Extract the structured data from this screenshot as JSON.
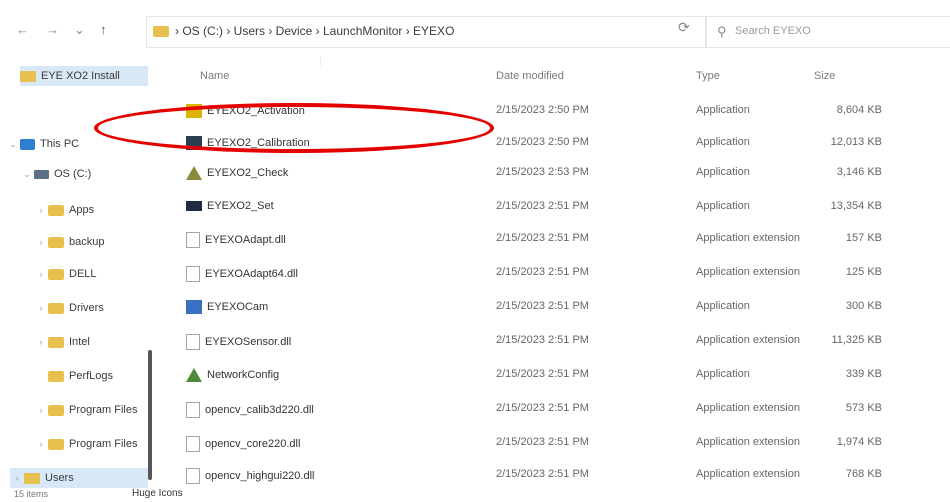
{
  "nav": {
    "back": "←",
    "forward": "→",
    "recent": "⌄",
    "up": "↑"
  },
  "address": {
    "path": "› OS (C:) › Users › Device › LaunchMonitor › EYEXO",
    "dropdown": "⌄",
    "refresh": "⟳"
  },
  "search": {
    "placeholder": "Search EYEXO",
    "icon": "search-icon"
  },
  "sidebar": {
    "items": [
      {
        "label": "EYE XO2 Install",
        "chev": ""
      },
      {
        "label": "This PC",
        "chev": "⌄"
      },
      {
        "label": "OS (C:)",
        "chev": "⌄"
      },
      {
        "label": "Apps",
        "chev": "›"
      },
      {
        "label": "backup",
        "chev": "›"
      },
      {
        "label": "DELL",
        "chev": "›"
      },
      {
        "label": "Drivers",
        "chev": "›"
      },
      {
        "label": "Intel",
        "chev": "›"
      },
      {
        "label": "PerfLogs",
        "chev": ""
      },
      {
        "label": "Program Files",
        "chev": "›"
      },
      {
        "label": "Program Files",
        "chev": "›"
      },
      {
        "label": "Users",
        "chev": "›"
      }
    ]
  },
  "columns": {
    "name": "Name",
    "date": "Date modified",
    "type": "Type",
    "size": "Size"
  },
  "files": [
    {
      "name": "EYEXO2_Activation",
      "date": "2/15/2023 2:50 PM",
      "type": "Application",
      "size": "8,604 KB",
      "icon": "activation-icon"
    },
    {
      "name": "EYEXO2_Calibration",
      "date": "2/15/2023 2:50 PM",
      "type": "Application",
      "size": "12,013 KB",
      "icon": "calibration-icon"
    },
    {
      "name": "EYEXO2_Check",
      "date": "2/15/2023 2:53 PM",
      "type": "Application",
      "size": "3,146 KB",
      "icon": "check-icon"
    },
    {
      "name": "EYEXO2_Set",
      "date": "2/15/2023 2:51 PM",
      "type": "Application",
      "size": "13,354 KB",
      "icon": "set-icon"
    },
    {
      "name": "EYEXOAdapt.dll",
      "date": "2/15/2023 2:51 PM",
      "type": "Application extension",
      "size": "157 KB",
      "icon": "dll-icon"
    },
    {
      "name": "EYEXOAdapt64.dll",
      "date": "2/15/2023 2:51 PM",
      "type": "Application extension",
      "size": "125 KB",
      "icon": "dll-icon"
    },
    {
      "name": "EYEXOCam",
      "date": "2/15/2023 2:51 PM",
      "type": "Application",
      "size": "300 KB",
      "icon": "camera-icon"
    },
    {
      "name": "EYEXOSensor.dll",
      "date": "2/15/2023 2:51 PM",
      "type": "Application extension",
      "size": "11,325 KB",
      "icon": "dll-icon"
    },
    {
      "name": "NetworkConfig",
      "date": "2/15/2023 2:51 PM",
      "type": "Application",
      "size": "339 KB",
      "icon": "network-icon"
    },
    {
      "name": "opencv_calib3d220.dll",
      "date": "2/15/2023 2:51 PM",
      "type": "Application extension",
      "size": "573 KB",
      "icon": "dll-icon"
    },
    {
      "name": "opencv_core220.dll",
      "date": "2/15/2023 2:51 PM",
      "type": "Application extension",
      "size": "1,974 KB",
      "icon": "dll-icon"
    },
    {
      "name": "opencv_highgui220.dll",
      "date": "2/15/2023 2:51 PM",
      "type": "Application extension",
      "size": "768 KB",
      "icon": "dll-icon"
    }
  ],
  "status": {
    "count": "15 items",
    "view": "Huge Icons"
  },
  "colors": {
    "highlight": "#e50000",
    "folder": "#e8c04e",
    "selected": "#d9e8f7"
  }
}
